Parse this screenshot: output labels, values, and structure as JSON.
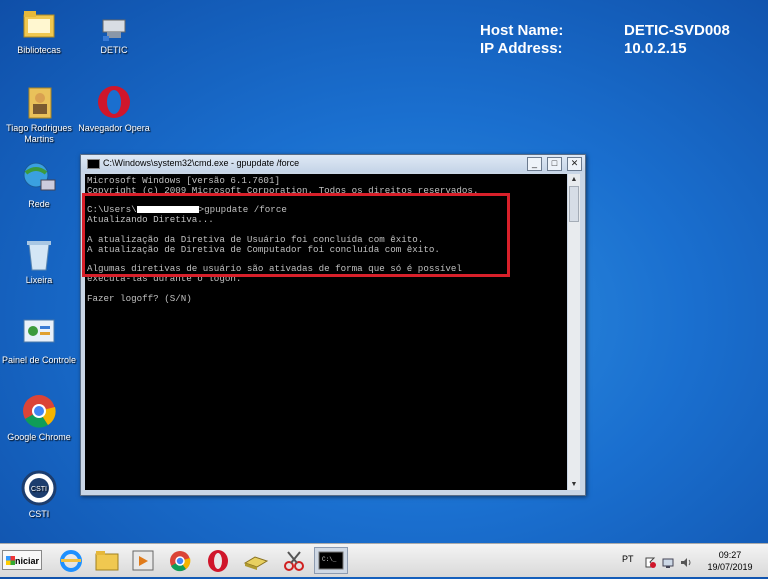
{
  "desktop": {
    "icons": [
      {
        "label": "Bibliotecas"
      },
      {
        "label": "DETIC"
      },
      {
        "label": "Tiago Rodrigues Martins"
      },
      {
        "label": "Navegador Opera"
      },
      {
        "label": "Rede"
      },
      {
        "label": "Lixeira"
      },
      {
        "label": "Painel de Controle"
      },
      {
        "label": "Google Chrome"
      },
      {
        "label": "CSTI"
      }
    ],
    "host_info": {
      "host_label": "Host Name:",
      "host_value": "DETIC-SVD008",
      "ip_label": "IP Address:",
      "ip_value": "10.0.2.15"
    }
  },
  "cmd_window": {
    "title": "C:\\Windows\\system32\\cmd.exe - gpupdate  /force",
    "lines": {
      "l1": "Microsoft Windows [versão 6.1.7601]",
      "l2": "Copyright (c) 2009 Microsoft Corporation. Todos os direitos reservados.",
      "l3a": "C:\\Users\\",
      "l3b": ">gpupdate /force",
      "l4": "Atualizando Diretiva...",
      "l5": "A atualização da Diretiva de Usuário foi concluída com êxito.",
      "l6": "A atualização de Diretiva de Computador foi concluída com êxito.",
      "l7": "Algumas diretivas de usuário são ativadas de forma que só é possível",
      "l8": "executá-las durante o logon.",
      "l9": "Fazer logoff? (S/N)"
    },
    "buttons": {
      "minimize": "_",
      "maximize": "□",
      "close": "✕"
    }
  },
  "taskbar": {
    "start_label": "Iniciar",
    "language": "PT",
    "time": "09:27",
    "date": "19/07/2019"
  },
  "colors": {
    "highlight": "#d8202a",
    "desktop": "#1a6fcf"
  }
}
